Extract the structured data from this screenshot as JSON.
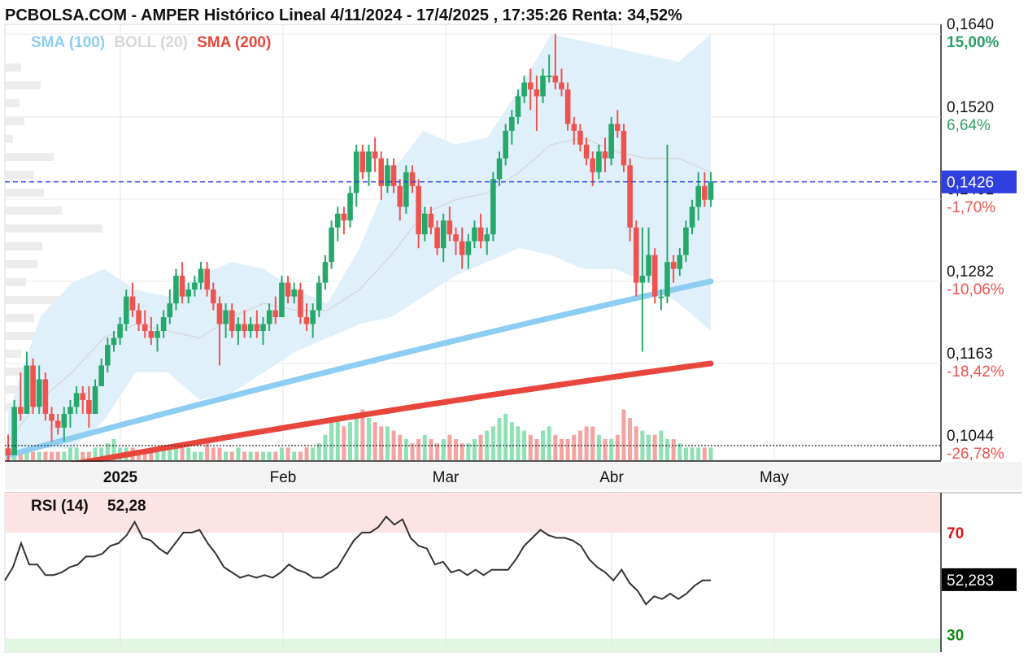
{
  "header": {
    "title": "PCBOLSA.COM - AMPER Histórico Lineal 4/11/2024 - 17/4/2025 , 17:35:26 Renta: 34,52%"
  },
  "legend": [
    {
      "label": "SMA (100)",
      "color": "#8ecdf2"
    },
    {
      "label": "BOLL (20)",
      "color": "#d6d6d6"
    },
    {
      "label": "SMA (200)",
      "color": "#e8463c"
    }
  ],
  "colors": {
    "up": "#26a86a",
    "down": "#ef5350",
    "band_fill": "#dff0fb",
    "rsi_line": "#333333",
    "current_line": "#2f3fe0",
    "rsi_overbought_fill": "#fde4e4",
    "rsi_oversold_fill": "#e2f7e2"
  },
  "price_axis": {
    "ticks": [
      {
        "price": "0,1640",
        "pct": "15,00%",
        "pct_color": "#2a9d66"
      },
      {
        "price": "0,1520",
        "pct": "6,64%",
        "pct_color": "#2a9d66"
      },
      {
        "price": "0,1401",
        "pct": "-1,70%",
        "pct_color": "#ef5350"
      },
      {
        "price": "0,1282",
        "pct": "-10,06%",
        "pct_color": "#ef5350"
      },
      {
        "price": "0,1163",
        "pct": "-18,42%",
        "pct_color": "#ef5350"
      },
      {
        "price": "0,1044",
        "pct": "-26,78%",
        "pct_color": "#ef5350"
      }
    ],
    "current_price_label": "0,1426"
  },
  "time_axis": {
    "labels": [
      {
        "text": "2025",
        "bold": true
      },
      {
        "text": "Feb",
        "bold": false
      },
      {
        "text": "Mar",
        "bold": false
      },
      {
        "text": "Abr",
        "bold": false
      },
      {
        "text": "May",
        "bold": false
      }
    ]
  },
  "rsi": {
    "label": "RSI (14)",
    "value": "52,28",
    "axis_value_label": "52,283",
    "levels": [
      {
        "text": "70",
        "color": "#dd1111"
      },
      {
        "text": "30",
        "color": "#118811"
      }
    ]
  },
  "chart_data": [
    {
      "type": "candlestick",
      "title": "PCBOLSA.COM - AMPER Histórico Lineal 4/11/2024 - 17/4/2025 , 17:35:26 Renta: 34,52%",
      "ylim": [
        0.1044,
        0.164
      ],
      "reference_close": 0.1426,
      "indicators": [
        "SMA (100)",
        "BOLL (20)",
        "SMA (200)"
      ],
      "candles": [
        [
          0.104,
          0.106,
          0.102,
          0.103
        ],
        [
          0.103,
          0.111,
          0.104,
          0.11
        ],
        [
          0.11,
          0.115,
          0.108,
          0.109
        ],
        [
          0.109,
          0.118,
          0.109,
          0.116
        ],
        [
          0.116,
          0.117,
          0.109,
          0.11
        ],
        [
          0.11,
          0.116,
          0.109,
          0.114
        ],
        [
          0.114,
          0.115,
          0.108,
          0.109
        ],
        [
          0.109,
          0.11,
          0.105,
          0.108
        ],
        [
          0.108,
          0.109,
          0.106,
          0.107
        ],
        [
          0.107,
          0.11,
          0.105,
          0.109
        ],
        [
          0.109,
          0.111,
          0.107,
          0.11
        ],
        [
          0.11,
          0.113,
          0.109,
          0.112
        ],
        [
          0.112,
          0.113,
          0.109,
          0.111
        ],
        [
          0.111,
          0.113,
          0.107,
          0.109
        ],
        [
          0.109,
          0.114,
          0.109,
          0.113
        ],
        [
          0.113,
          0.117,
          0.113,
          0.116
        ],
        [
          0.116,
          0.12,
          0.115,
          0.119
        ],
        [
          0.119,
          0.121,
          0.118,
          0.12
        ],
        [
          0.12,
          0.123,
          0.119,
          0.122
        ],
        [
          0.122,
          0.127,
          0.121,
          0.126
        ],
        [
          0.126,
          0.128,
          0.123,
          0.124
        ],
        [
          0.124,
          0.125,
          0.121,
          0.122
        ],
        [
          0.122,
          0.124,
          0.12,
          0.121
        ],
        [
          0.121,
          0.123,
          0.119,
          0.12
        ],
        [
          0.12,
          0.122,
          0.118,
          0.121
        ],
        [
          0.121,
          0.124,
          0.12,
          0.123
        ],
        [
          0.123,
          0.127,
          0.122,
          0.125
        ],
        [
          0.125,
          0.13,
          0.124,
          0.129
        ],
        [
          0.129,
          0.131,
          0.125,
          0.126
        ],
        [
          0.126,
          0.128,
          0.125,
          0.127
        ],
        [
          0.127,
          0.129,
          0.126,
          0.128
        ],
        [
          0.128,
          0.131,
          0.127,
          0.13
        ],
        [
          0.13,
          0.131,
          0.126,
          0.127
        ],
        [
          0.127,
          0.128,
          0.124,
          0.125
        ],
        [
          0.125,
          0.126,
          0.116,
          0.122
        ],
        [
          0.122,
          0.125,
          0.12,
          0.124
        ],
        [
          0.124,
          0.125,
          0.12,
          0.121
        ],
        [
          0.121,
          0.123,
          0.119,
          0.122
        ],
        [
          0.122,
          0.124,
          0.12,
          0.121
        ],
        [
          0.121,
          0.123,
          0.12,
          0.122
        ],
        [
          0.122,
          0.124,
          0.12,
          0.121
        ],
        [
          0.121,
          0.123,
          0.119,
          0.122
        ],
        [
          0.122,
          0.125,
          0.121,
          0.124
        ],
        [
          0.124,
          0.126,
          0.122,
          0.123
        ],
        [
          0.123,
          0.129,
          0.123,
          0.128
        ],
        [
          0.128,
          0.129,
          0.125,
          0.126
        ],
        [
          0.126,
          0.128,
          0.125,
          0.127
        ],
        [
          0.127,
          0.128,
          0.122,
          0.123
        ],
        [
          0.123,
          0.125,
          0.121,
          0.122
        ],
        [
          0.122,
          0.125,
          0.12,
          0.124
        ],
        [
          0.124,
          0.129,
          0.123,
          0.128
        ],
        [
          0.128,
          0.132,
          0.127,
          0.131
        ],
        [
          0.131,
          0.137,
          0.13,
          0.136
        ],
        [
          0.136,
          0.139,
          0.134,
          0.138
        ],
        [
          0.138,
          0.139,
          0.135,
          0.137
        ],
        [
          0.137,
          0.142,
          0.136,
          0.141
        ],
        [
          0.141,
          0.148,
          0.139,
          0.147
        ],
        [
          0.147,
          0.148,
          0.143,
          0.144
        ],
        [
          0.144,
          0.148,
          0.142,
          0.147
        ],
        [
          0.147,
          0.149,
          0.144,
          0.146
        ],
        [
          0.146,
          0.147,
          0.14,
          0.142
        ],
        [
          0.142,
          0.146,
          0.141,
          0.145
        ],
        [
          0.145,
          0.146,
          0.141,
          0.142
        ],
        [
          0.142,
          0.143,
          0.137,
          0.139
        ],
        [
          0.139,
          0.145,
          0.138,
          0.144
        ],
        [
          0.144,
          0.145,
          0.141,
          0.142
        ],
        [
          0.142,
          0.143,
          0.133,
          0.135
        ],
        [
          0.135,
          0.139,
          0.134,
          0.138
        ],
        [
          0.138,
          0.139,
          0.135,
          0.136
        ],
        [
          0.136,
          0.137,
          0.132,
          0.133
        ],
        [
          0.133,
          0.138,
          0.131,
          0.137
        ],
        [
          0.137,
          0.139,
          0.134,
          0.135
        ],
        [
          0.135,
          0.136,
          0.132,
          0.134
        ],
        [
          0.134,
          0.136,
          0.13,
          0.132
        ],
        [
          0.132,
          0.135,
          0.13,
          0.134
        ],
        [
          0.134,
          0.137,
          0.133,
          0.136
        ],
        [
          0.136,
          0.138,
          0.133,
          0.134
        ],
        [
          0.134,
          0.136,
          0.132,
          0.135
        ],
        [
          0.135,
          0.144,
          0.134,
          0.143
        ],
        [
          0.143,
          0.147,
          0.142,
          0.146
        ],
        [
          0.146,
          0.151,
          0.145,
          0.15
        ],
        [
          0.15,
          0.153,
          0.148,
          0.152
        ],
        [
          0.152,
          0.156,
          0.151,
          0.155
        ],
        [
          0.155,
          0.158,
          0.154,
          0.157
        ],
        [
          0.157,
          0.159,
          0.153,
          0.156
        ],
        [
          0.156,
          0.158,
          0.15,
          0.155
        ],
        [
          0.155,
          0.159,
          0.154,
          0.158
        ],
        [
          0.158,
          0.161,
          0.157,
          0.158
        ],
        [
          0.158,
          0.164,
          0.156,
          0.157
        ],
        [
          0.157,
          0.159,
          0.155,
          0.156
        ],
        [
          0.156,
          0.157,
          0.15,
          0.151
        ],
        [
          0.151,
          0.152,
          0.148,
          0.15
        ],
        [
          0.15,
          0.151,
          0.147,
          0.148
        ],
        [
          0.148,
          0.149,
          0.145,
          0.146
        ],
        [
          0.146,
          0.147,
          0.142,
          0.144
        ],
        [
          0.144,
          0.148,
          0.143,
          0.147
        ],
        [
          0.147,
          0.149,
          0.144,
          0.146
        ],
        [
          0.146,
          0.152,
          0.145,
          0.151
        ],
        [
          0.151,
          0.153,
          0.149,
          0.15
        ],
        [
          0.15,
          0.151,
          0.144,
          0.145
        ],
        [
          0.145,
          0.146,
          0.134,
          0.136
        ],
        [
          0.136,
          0.137,
          0.126,
          0.128
        ],
        [
          0.128,
          0.136,
          0.118,
          0.129
        ],
        [
          0.129,
          0.136,
          0.128,
          0.132
        ],
        [
          0.132,
          0.133,
          0.125,
          0.126
        ],
        [
          0.126,
          0.127,
          0.124,
          0.126
        ],
        [
          0.126,
          0.148,
          0.125,
          0.131
        ],
        [
          0.131,
          0.132,
          0.128,
          0.13
        ],
        [
          0.13,
          0.133,
          0.129,
          0.132
        ],
        [
          0.132,
          0.137,
          0.131,
          0.136
        ],
        [
          0.136,
          0.14,
          0.135,
          0.139
        ],
        [
          0.139,
          0.144,
          0.137,
          0.142
        ],
        [
          0.142,
          0.144,
          0.139,
          0.14
        ],
        [
          0.14,
          0.144,
          0.139,
          0.1426
        ]
      ],
      "sma100_start_end": [
        0.103,
        0.1282
      ],
      "sma200_start_end": [
        0.1,
        0.1163
      ],
      "bollinger_upper": [
        0.109,
        0.123,
        0.128,
        0.13,
        0.127,
        0.126,
        0.129,
        0.131,
        0.13,
        0.127,
        0.125,
        0.133,
        0.144,
        0.15,
        0.148,
        0.149,
        0.156,
        0.164,
        0.163,
        0.162,
        0.161,
        0.16,
        0.164
      ],
      "bollinger_middle": [
        0.105,
        0.111,
        0.115,
        0.12,
        0.122,
        0.121,
        0.12,
        0.123,
        0.125,
        0.124,
        0.124,
        0.127,
        0.132,
        0.138,
        0.14,
        0.141,
        0.144,
        0.148,
        0.149,
        0.147,
        0.146,
        0.146,
        0.144
      ],
      "bollinger_lower": [
        0.102,
        0.104,
        0.104,
        0.108,
        0.115,
        0.115,
        0.111,
        0.112,
        0.115,
        0.118,
        0.12,
        0.122,
        0.123,
        0.126,
        0.129,
        0.131,
        0.133,
        0.132,
        0.13,
        0.13,
        0.128,
        0.125,
        0.121
      ],
      "volume": [
        3,
        2,
        2,
        3,
        2,
        2,
        2,
        2,
        2,
        2,
        3,
        3,
        2,
        2,
        3,
        3,
        4,
        5,
        3,
        3,
        3,
        2,
        2,
        2,
        2,
        3,
        3,
        3,
        4,
        3,
        2,
        2,
        4,
        3,
        3,
        2,
        2,
        3,
        2,
        2,
        2,
        2,
        2,
        2,
        3,
        3,
        2,
        2,
        3,
        3,
        4,
        6,
        9,
        10,
        8,
        9,
        11,
        12,
        10,
        9,
        8,
        8,
        7,
        6,
        5,
        4,
        5,
        6,
        5,
        4,
        5,
        6,
        5,
        4,
        4,
        5,
        6,
        7,
        8,
        10,
        11,
        9,
        8,
        7,
        6,
        5,
        7,
        8,
        6,
        5,
        5,
        6,
        7,
        8,
        8,
        6,
        5,
        5,
        6,
        12,
        10,
        8,
        7,
        6,
        6,
        7,
        5,
        5,
        4,
        3,
        3,
        3,
        3,
        3,
        3,
        3,
        3,
        3,
        3,
        3,
        3,
        3,
        3,
        3,
        3,
        3,
        3,
        3,
        3,
        3
      ],
      "xlabels": [
        "2025",
        "Feb",
        "Mar",
        "Abr",
        "May"
      ]
    },
    {
      "type": "line",
      "title": "RSI (14)",
      "ylim": [
        25,
        85
      ],
      "overbought": 70,
      "oversold": 30,
      "last_value": 52.28,
      "values": [
        52,
        57,
        66,
        58,
        58,
        54,
        54,
        55,
        57,
        58,
        61,
        61,
        62,
        65,
        66,
        69,
        74,
        68,
        67,
        64,
        62,
        66,
        70,
        70,
        71,
        66,
        62,
        57,
        55,
        53,
        54,
        53,
        54,
        53,
        55,
        58,
        56,
        55,
        53,
        53,
        55,
        57,
        62,
        67,
        70,
        70,
        72,
        76,
        73,
        75,
        68,
        65,
        64,
        58,
        59,
        55,
        56,
        54,
        56,
        54,
        56,
        56,
        56,
        60,
        65,
        68,
        71,
        69,
        68,
        68,
        67,
        65,
        60,
        57,
        55,
        52,
        56,
        51,
        48,
        43,
        46,
        45,
        47,
        45,
        47,
        50,
        52,
        52
      ],
      "xlabels": [
        "2025",
        "Feb",
        "Mar",
        "Abr",
        "May"
      ]
    }
  ]
}
